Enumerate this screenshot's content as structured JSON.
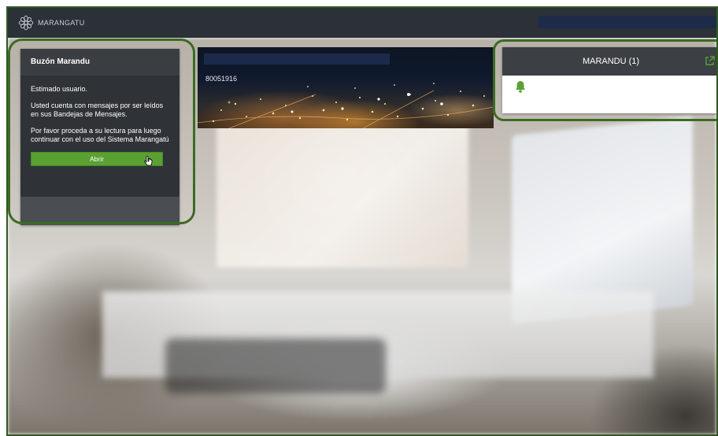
{
  "topbar": {
    "logo_text": "MARANGATU"
  },
  "message_box": {
    "title": "Buzón Marandu",
    "greeting": "Estimado usuario.",
    "paragraph1": "Usted cuenta con mensajes por ser leídos en sus Bandejas de Mensajes.",
    "paragraph2": "Por favor proceda a su lectura para luego continuar con el uso del Sistema Marangatú",
    "button_label": "Abrir"
  },
  "banner": {
    "id_number": "80051916"
  },
  "marandu_panel": {
    "title": "MARANDU (1)",
    "icon": "external-link-icon",
    "bell_icon": "bell-icon"
  },
  "colors": {
    "accent_green": "#5aa132",
    "highlight_green": "#3b6b24",
    "topbar": "#2b3137",
    "panel_dark": "#2f3337"
  }
}
